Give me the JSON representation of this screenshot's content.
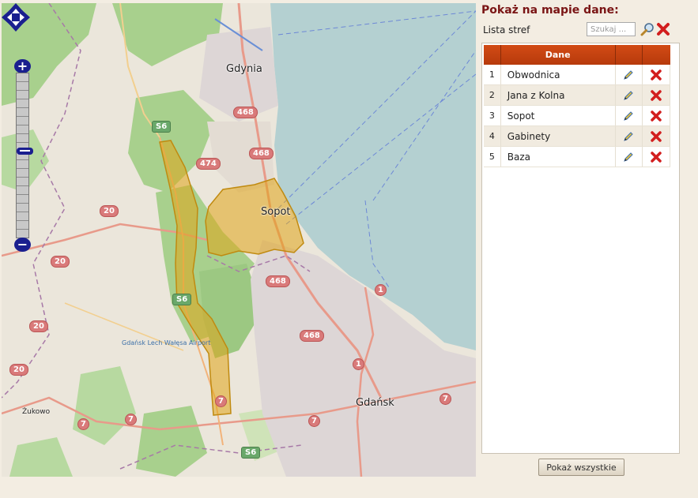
{
  "map": {
    "places": {
      "gdynia": "Gdynia",
      "sopot": "Sopot",
      "gdansk": "Gdańsk",
      "zukowo": "Żukowo",
      "airport": "Gdańsk Lech Wałęsa Airport"
    },
    "road_shields": {
      "r468a": "468",
      "r468b": "468",
      "r468c": "468",
      "r468d": "468",
      "r474": "474",
      "s6a": "S6",
      "s6b": "S6",
      "s6c": "S6",
      "r20a": "20",
      "r20b": "20",
      "r20c": "20",
      "r20d": "20",
      "r7a": "7",
      "r7b": "7",
      "r7c": "7",
      "r7d": "7",
      "r7e": "7",
      "r1a": "1",
      "r1b": "1"
    },
    "zoom_in": "+",
    "zoom_out": "−"
  },
  "panel": {
    "title": "Pokaż na mapie dane:",
    "zones_label": "Lista stref",
    "search_placeholder": "Szukaj ...",
    "table": {
      "header": {
        "num": "",
        "name": "Dane",
        "edit": "",
        "delete": ""
      },
      "rows": [
        {
          "num": "1",
          "name": "Obwodnica"
        },
        {
          "num": "2",
          "name": "Jana z Kolna"
        },
        {
          "num": "3",
          "name": "Sopot"
        },
        {
          "num": "4",
          "name": "Gabinety"
        },
        {
          "num": "5",
          "name": "Baza"
        }
      ]
    },
    "show_all": "Pokaż wszystkie"
  },
  "colors": {
    "title": "#7a1515",
    "header": "#c4420f",
    "zone_fill": "#e0a418",
    "sea": "#b4d0d1",
    "nav": "#1a1f8f"
  },
  "icons": {
    "edit": "pencil-icon",
    "delete": "red-x-icon",
    "search": "magnifier-icon",
    "clear": "red-x-icon"
  }
}
